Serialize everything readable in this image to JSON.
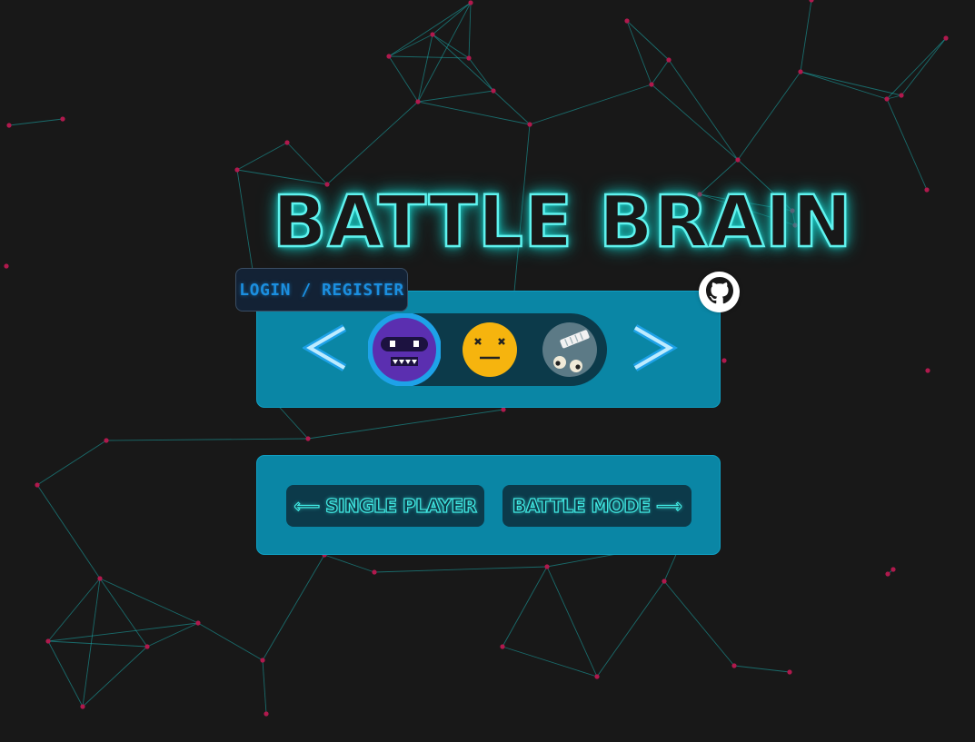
{
  "header": {
    "title": "BATTLE BRAIN"
  },
  "auth": {
    "login_label": "LOGIN / REGISTER"
  },
  "links": {
    "github_icon": "github-icon"
  },
  "avatar_picker": {
    "prev_label": "<",
    "next_label": ">",
    "selected_index": 0,
    "avatars": [
      {
        "icon": "robot-ninja-icon",
        "color": "#5b2fb0"
      },
      {
        "icon": "dizzy-face-icon",
        "color": "#f6b40e"
      },
      {
        "icon": "bandaged-face-icon",
        "color": "#5c7a86"
      }
    ],
    "selection_ring_color": "#1ea2e8"
  },
  "modes": {
    "single_label": "⟵ SINGLE PLAYER",
    "battle_label": "BATTLE MODE ⟶"
  },
  "theme": {
    "background": "#181818",
    "panel": "#0a86a5",
    "neon": "#40e9e3",
    "network_line": "#1bb1b0",
    "network_node": "#b0194d"
  }
}
